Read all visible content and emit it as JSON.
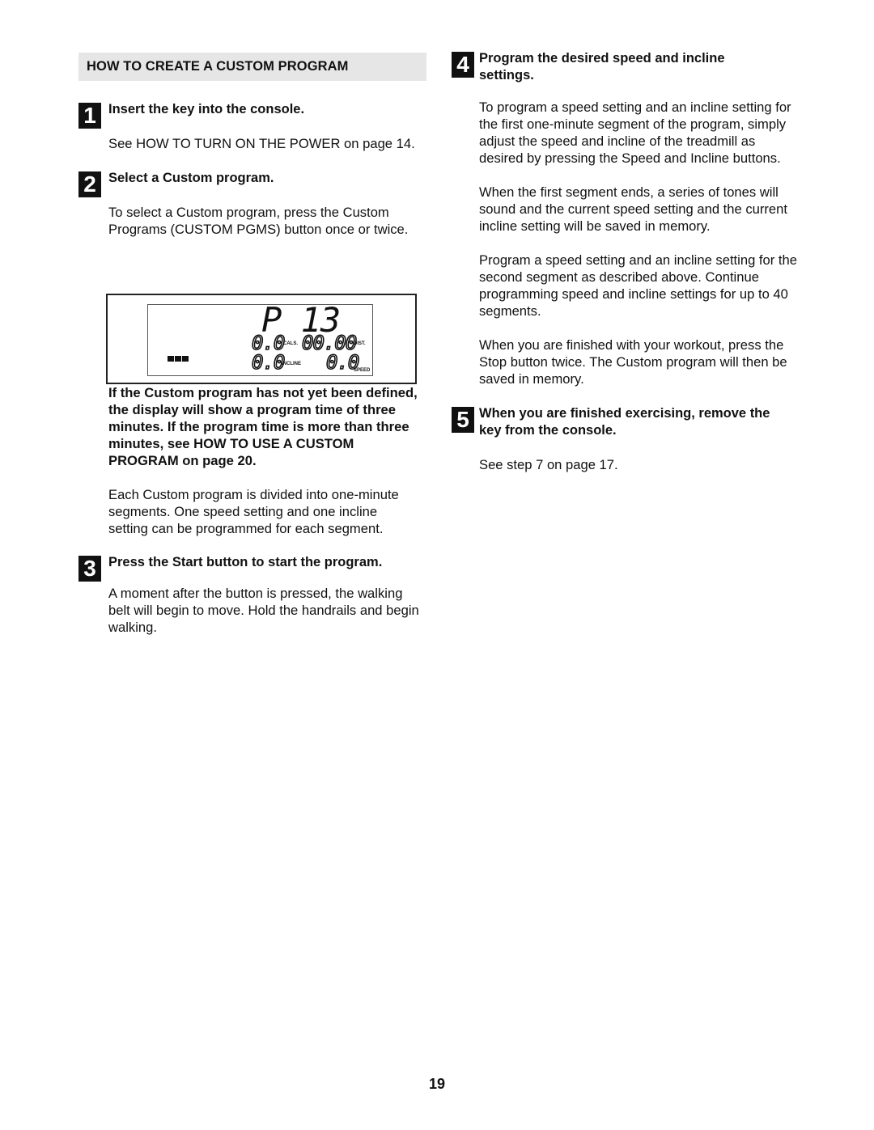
{
  "section_title": "HOW TO CREATE A CUSTOM PROGRAM",
  "steps": [
    {
      "number": "1",
      "title": "Insert the key into the console.",
      "paragraphs": [
        "See HOW TO TURN ON THE POWER on page 14."
      ]
    },
    {
      "number": "2",
      "title": "Select a Custom program.",
      "paragraphs": [
        "To select a Custom program, press the Custom Programs (CUSTOM PGMS) button once or twice.",
        "If the Custom program has not yet been defined, the display will show a program time of three minutes. If the program time is more than three minutes, see HOW TO USE A CUSTOM PROGRAM on page 20.",
        "Each Custom program is divided into one-minute segments. One speed setting and one incline setting can be programmed for each segment."
      ]
    },
    {
      "number": "3",
      "title": "Press the Start button to start the program.",
      "paragraphs": [
        "A moment after the button is pressed, the walking belt will begin to move. Hold the handrails and begin walking."
      ]
    },
    {
      "number": "4",
      "title": "Program the desired speed and incline settings.",
      "paragraphs": [
        "To program a speed setting and an incline setting for the first one-minute segment of the program, simply adjust the speed and incline of the treadmill as desired by pressing the Speed and Incline buttons.",
        "When the first segment ends, a series of tones will sound and the current speed setting and the current incline setting will be saved in memory.",
        "Program a speed setting and an incline setting for the second segment as described above. Continue programming speed and incline settings for up to 40 segments.",
        "When you are finished with your workout, press the Stop button twice. The Custom program will then be saved in memory."
      ]
    },
    {
      "number": "5",
      "title": "When you are finished exercising, remove the key from the console.",
      "paragraphs": [
        "See step 7 on page 17."
      ]
    }
  ],
  "display": {
    "program": "P 13",
    "calories": "0.0",
    "calories_label": "CALS.",
    "distance": "00.00",
    "distance_label": "DIST.",
    "incline": "0.0",
    "incline_label": "INCLINE",
    "speed": "0.0",
    "speed_label": "SPEED"
  },
  "page_number": "19"
}
